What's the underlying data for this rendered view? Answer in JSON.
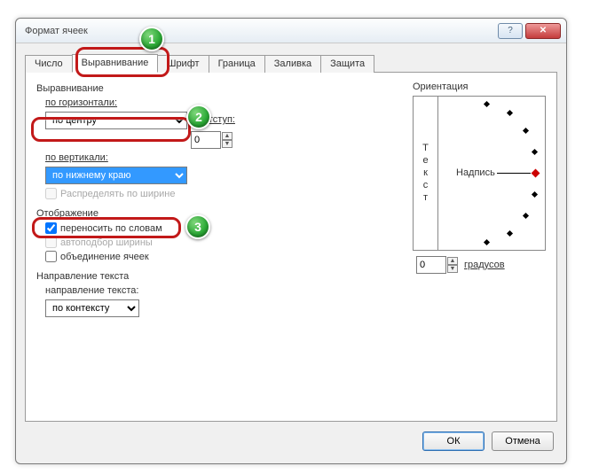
{
  "window": {
    "title": "Формат ячеек"
  },
  "tabs": {
    "number": "Число",
    "alignment": "Выравнивание",
    "font": "Шрифт",
    "border": "Граница",
    "fill": "Заливка",
    "protection": "Защита"
  },
  "alignment": {
    "group": "Выравнивание",
    "horizontal_label": "по горизонтали:",
    "horizontal_value": "по центру",
    "indent_label": "отступ:",
    "indent_value": "0",
    "vertical_label": "по вертикали:",
    "vertical_value": "по нижнему краю",
    "distribute": "Распределять по ширине"
  },
  "display": {
    "group": "Отображение",
    "wrap": "переносить по словам",
    "autofit": "автоподбор ширины",
    "merge": "объединение ячеек"
  },
  "direction": {
    "group": "Направление текста",
    "label": "направление текста:",
    "value": "по контексту"
  },
  "orientation": {
    "group": "Ориентация",
    "text_vertical": "Текст",
    "caption": "Надпись",
    "degrees_value": "0",
    "degrees_label": "градусов"
  },
  "buttons": {
    "ok": "ОК",
    "cancel": "Отмена"
  },
  "markers": {
    "m1": "1",
    "m2": "2",
    "m3": "3"
  }
}
